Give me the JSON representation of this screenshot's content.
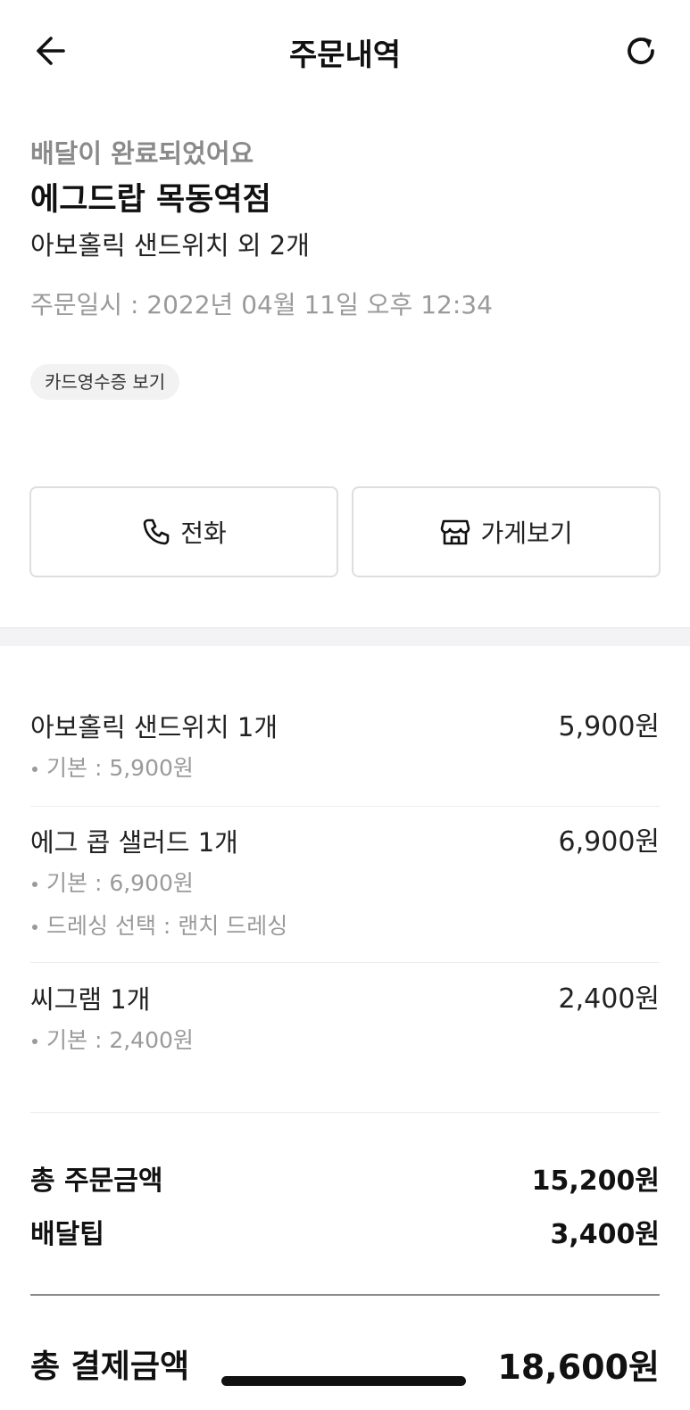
{
  "header": {
    "title": "주문내역",
    "back_icon": "arrow-left-icon",
    "refresh_icon": "refresh-icon"
  },
  "summary": {
    "status": "배달이 완료되었어요",
    "store_name": "에그드랍 목동역점",
    "order_items": "아보홀릭 샌드위치 외 2개",
    "order_date": "주문일시 : 2022년 04월 11일 오후 12:34",
    "receipt_label": "카드영수증 보기"
  },
  "actions": {
    "call_label": "전화",
    "call_icon": "phone-icon",
    "store_label": "가게보기",
    "store_icon": "store-icon"
  },
  "items": [
    {
      "name": "아보홀릭 샌드위치 1개",
      "price": "5,900원",
      "options": [
        "기본 : 5,900원"
      ]
    },
    {
      "name": "에그 콥 샐러드 1개",
      "price": "6,900원",
      "options": [
        "기본 : 6,900원",
        "드레싱 선택 : 랜치 드레싱"
      ]
    },
    {
      "name": "씨그램 1개",
      "price": "2,400원",
      "options": [
        "기본 : 2,400원"
      ]
    }
  ],
  "totals": {
    "order_total_label": "총 주문금액",
    "order_total_value": "15,200원",
    "delivery_tip_label": "배달팁",
    "delivery_tip_value": "3,400원",
    "grand_total_label": "총 결제금액",
    "grand_total_value": "18,600원"
  }
}
